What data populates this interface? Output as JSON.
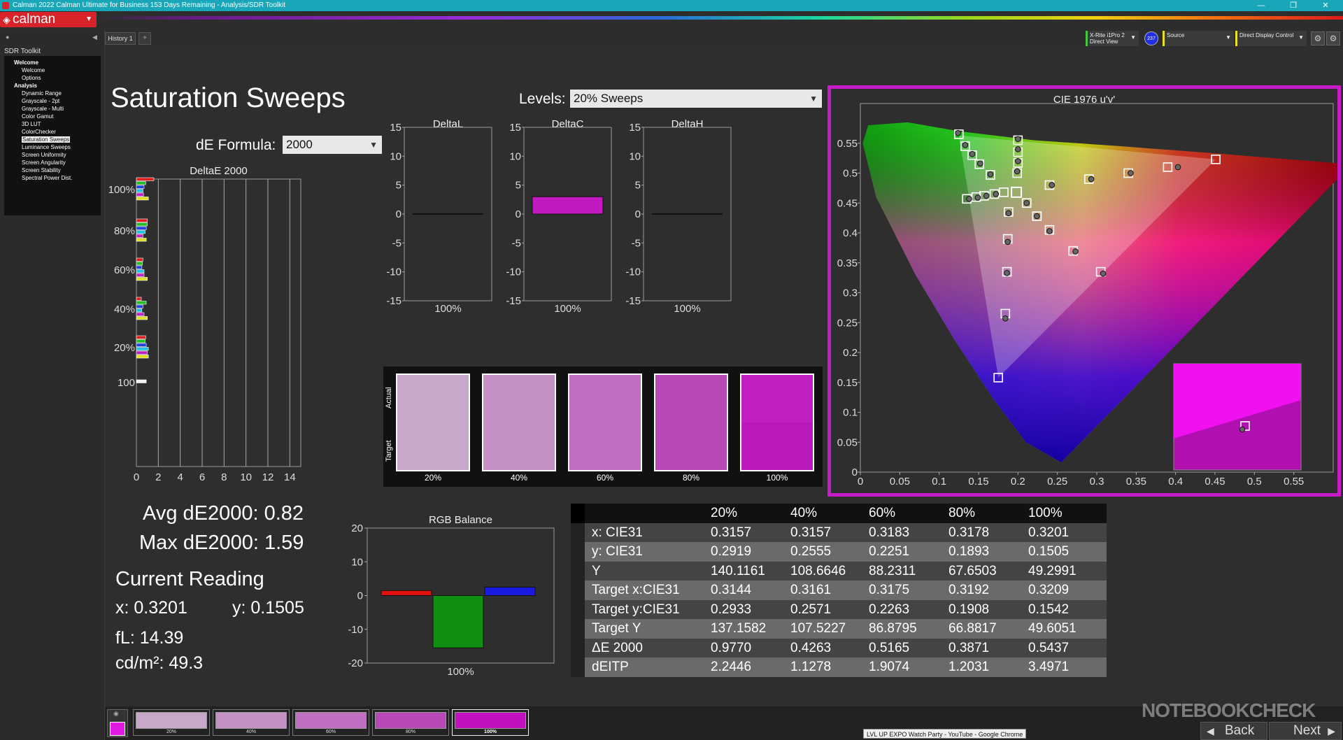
{
  "window": {
    "title": "Calman 2022 Calman Ultimate for Business 153 Days Remaining  - Analysis/SDR Toolkit",
    "min": "—",
    "max": "❐",
    "close": "✕"
  },
  "app": {
    "logo": "calman",
    "logo_icon": "calman-diamond-icon"
  },
  "sidebar": {
    "header": "SDR Toolkit",
    "items": [
      {
        "label": "Welcome",
        "type": "section"
      },
      {
        "label": "Welcome",
        "type": "item"
      },
      {
        "label": "Options",
        "type": "item"
      },
      {
        "label": "Analysis",
        "type": "section"
      },
      {
        "label": "Dynamic Range",
        "type": "item"
      },
      {
        "label": "Grayscale - 2pt",
        "type": "item"
      },
      {
        "label": "Grayscale - Multi",
        "type": "item"
      },
      {
        "label": "Color Gamut",
        "type": "item"
      },
      {
        "label": "3D LUT",
        "type": "item"
      },
      {
        "label": "ColorChecker",
        "type": "item"
      },
      {
        "label": "Saturation Sweeps",
        "type": "item",
        "selected": true
      },
      {
        "label": "Luminance Sweeps",
        "type": "item"
      },
      {
        "label": "Screen Uniformity",
        "type": "item"
      },
      {
        "label": "Screen Angularity",
        "type": "item"
      },
      {
        "label": "Screen Stability",
        "type": "item"
      },
      {
        "label": "Spectral Power Dist.",
        "type": "item"
      }
    ]
  },
  "tabs": {
    "history": "History 1",
    "add": "+"
  },
  "devices": {
    "meter_line1": "X-Rite i1Pro 2",
    "meter_line2": "Direct View",
    "meter_badge": "237",
    "source": "Source",
    "display": "Direct Display Control",
    "meter_color": "#3fc93f",
    "source_color": "#e8e020",
    "display_color": "#e8e020"
  },
  "page": {
    "title": "Saturation Sweeps",
    "levels_label": "Levels:",
    "levels_value": "20% Sweeps",
    "de_formula_label": "dE Formula:",
    "de_formula_value": "2000"
  },
  "deltaE_chart": {
    "title": "DeltaE 2000",
    "x_ticks": [
      "0",
      "2",
      "4",
      "6",
      "8",
      "10",
      "12",
      "14"
    ],
    "y_labels": [
      "100%",
      "80%",
      "60%",
      "40%",
      "20%",
      "100"
    ],
    "xlim": [
      0,
      15
    ],
    "groups": [
      {
        "label": "100%",
        "values": [
          1.59,
          0.85,
          0.7,
          0.6,
          0.65,
          1.1
        ],
        "colors": [
          "#e02020",
          "#20c020",
          "#2040e0",
          "#20c0e0",
          "#c020c0",
          "#e0e020"
        ]
      },
      {
        "label": "80%",
        "values": [
          1.0,
          1.0,
          0.9,
          0.8,
          0.6,
          0.9
        ],
        "colors": [
          "#e02020",
          "#20c020",
          "#2040e0",
          "#20c0e0",
          "#c020c0",
          "#e0e020"
        ]
      },
      {
        "label": "60%",
        "values": [
          0.6,
          0.55,
          0.5,
          0.7,
          0.7,
          1.0
        ],
        "colors": [
          "#e02020",
          "#20c020",
          "#2040e0",
          "#20c0e0",
          "#c020c0",
          "#e0e020"
        ]
      },
      {
        "label": "40%",
        "values": [
          0.45,
          0.9,
          0.6,
          0.5,
          0.7,
          1.0
        ],
        "colors": [
          "#e02020",
          "#20c020",
          "#2040e0",
          "#20c0e0",
          "#c020c0",
          "#e0e020"
        ]
      },
      {
        "label": "20%",
        "values": [
          0.85,
          0.8,
          0.9,
          1.1,
          1.0,
          1.1
        ],
        "colors": [
          "#e02020",
          "#20c020",
          "#2040e0",
          "#20c0e0",
          "#c020c0",
          "#e0e020"
        ]
      },
      {
        "label": "100",
        "values": [
          0.9
        ],
        "colors": [
          "#f0f0f0"
        ]
      }
    ]
  },
  "delta_charts": [
    {
      "title": "DeltaL",
      "value": 0.0,
      "color": "#111111",
      "xlabel": "100%"
    },
    {
      "title": "DeltaC",
      "value": 3.0,
      "color": "#c01ac0",
      "xlabel": "100%"
    },
    {
      "title": "DeltaH",
      "value": 0.0,
      "color": "#111111",
      "xlabel": "100%"
    }
  ],
  "delta_y_ticks": [
    "15",
    "10",
    "5",
    "0",
    "-5",
    "-10",
    "-15"
  ],
  "swatches": {
    "actual_label": "Actual",
    "target_label": "Target",
    "items": [
      {
        "label": "20%",
        "actual": "#c8a8c8",
        "target": "#c8a8c8"
      },
      {
        "label": "40%",
        "actual": "#c590c5",
        "target": "#c590c5"
      },
      {
        "label": "60%",
        "actual": "#c06fc0",
        "target": "#c06fc0"
      },
      {
        "label": "80%",
        "actual": "#b848b8",
        "target": "#b848b8"
      },
      {
        "label": "100%",
        "actual": "#c020c0",
        "target": "#bb1abb"
      }
    ]
  },
  "summary": {
    "avg": "Avg dE2000: 0.82",
    "max": "Max dE2000: 1.59",
    "current": "Current Reading",
    "x": "x: 0.3201",
    "y": "y: 0.1505",
    "fl": "fL: 14.39",
    "cdm2": "cd/m²: 49.3"
  },
  "rgb_balance": {
    "title": "RGB Balance",
    "xlabel": "100%",
    "y_ticks": [
      "20",
      "10",
      "0",
      "-10",
      "-20"
    ],
    "ylim": [
      -20,
      20
    ],
    "values": [
      1.5,
      -15.5,
      2.5
    ],
    "colors": [
      "#e01010",
      "#109010",
      "#1a1ae0"
    ]
  },
  "cie": {
    "title": "CIE 1976 u'v'",
    "x_ticks": [
      "0",
      "0.05",
      "0.1",
      "0.15",
      "0.2",
      "0.25",
      "0.3",
      "0.35",
      "0.4",
      "0.45",
      "0.5",
      "0.55"
    ],
    "y_ticks": [
      "0",
      "0.05",
      "0.1",
      "0.15",
      "0.2",
      "0.25",
      "0.3",
      "0.35",
      "0.4",
      "0.45",
      "0.5",
      "0.55"
    ],
    "xlim": [
      0,
      0.6
    ],
    "ylim": [
      0,
      0.6
    ],
    "white": [
      0.198,
      0.468
    ],
    "targets": [
      [
        0.125,
        0.565
      ],
      [
        0.451,
        0.523
      ],
      [
        0.175,
        0.158
      ],
      [
        0.133,
        0.545
      ],
      [
        0.142,
        0.53
      ],
      [
        0.151,
        0.515
      ],
      [
        0.165,
        0.497
      ],
      [
        0.2,
        0.555
      ],
      [
        0.2,
        0.535
      ],
      [
        0.2,
        0.517
      ],
      [
        0.199,
        0.5
      ],
      [
        0.24,
        0.48
      ],
      [
        0.29,
        0.49
      ],
      [
        0.34,
        0.5
      ],
      [
        0.39,
        0.51
      ],
      [
        0.188,
        0.435
      ],
      [
        0.187,
        0.39
      ],
      [
        0.186,
        0.335
      ],
      [
        0.184,
        0.265
      ],
      [
        0.211,
        0.45
      ],
      [
        0.224,
        0.428
      ],
      [
        0.24,
        0.405
      ],
      [
        0.27,
        0.37
      ],
      [
        0.305,
        0.335
      ],
      [
        0.135,
        0.457
      ],
      [
        0.147,
        0.46
      ],
      [
        0.157,
        0.462
      ],
      [
        0.17,
        0.465
      ],
      [
        0.182,
        0.468
      ]
    ],
    "measured": [
      [
        0.124,
        0.567
      ],
      [
        0.403,
        0.51
      ],
      [
        0.133,
        0.547
      ],
      [
        0.142,
        0.532
      ],
      [
        0.152,
        0.516
      ],
      [
        0.165,
        0.498
      ],
      [
        0.2,
        0.557
      ],
      [
        0.2,
        0.54
      ],
      [
        0.2,
        0.52
      ],
      [
        0.199,
        0.503
      ],
      [
        0.243,
        0.48
      ],
      [
        0.293,
        0.49
      ],
      [
        0.343,
        0.5
      ],
      [
        0.188,
        0.433
      ],
      [
        0.187,
        0.385
      ],
      [
        0.186,
        0.333
      ],
      [
        0.184,
        0.257
      ],
      [
        0.211,
        0.45
      ],
      [
        0.224,
        0.428
      ],
      [
        0.24,
        0.403
      ],
      [
        0.273,
        0.369
      ],
      [
        0.308,
        0.332
      ],
      [
        0.138,
        0.457
      ],
      [
        0.149,
        0.459
      ],
      [
        0.16,
        0.462
      ],
      [
        0.172,
        0.465
      ]
    ]
  },
  "data_table": {
    "columns": [
      "",
      "20%",
      "40%",
      "60%",
      "80%",
      "100%"
    ],
    "rows": [
      [
        "x: CIE31",
        "0.3157",
        "0.3157",
        "0.3183",
        "0.3178",
        "0.3201"
      ],
      [
        "y: CIE31",
        "0.2919",
        "0.2555",
        "0.2251",
        "0.1893",
        "0.1505"
      ],
      [
        "Y",
        "140.1161",
        "108.6646",
        "88.2311",
        "67.6503",
        "49.2991"
      ],
      [
        "Target x:CIE31",
        "0.3144",
        "0.3161",
        "0.3175",
        "0.3192",
        "0.3209"
      ],
      [
        "Target y:CIE31",
        "0.2933",
        "0.2571",
        "0.2263",
        "0.1908",
        "0.1542"
      ],
      [
        "Target Y",
        "137.1582",
        "107.5227",
        "86.8795",
        "66.8817",
        "49.6051"
      ],
      [
        "ΔE 2000",
        "0.9770",
        "0.4263",
        "0.5165",
        "0.3871",
        "0.5437"
      ],
      [
        "dEITP",
        "2.2446",
        "1.1278",
        "1.9074",
        "1.2031",
        "3.4971"
      ]
    ]
  },
  "bottom": {
    "current_color": "#e01ae0",
    "swatches": [
      {
        "label": "20%",
        "color": "#c8a8c8"
      },
      {
        "label": "40%",
        "color": "#c590c5"
      },
      {
        "label": "60%",
        "color": "#c06fc0"
      },
      {
        "label": "80%",
        "color": "#b848b8"
      },
      {
        "label": "100%",
        "color": "#c010c0"
      }
    ],
    "back": "Back",
    "next": "Next"
  },
  "watermark": "NOTEBOOKCHECK",
  "taskbar_popup": "LVL UP EXPO Watch Party - YouTube - Google Chrome"
}
